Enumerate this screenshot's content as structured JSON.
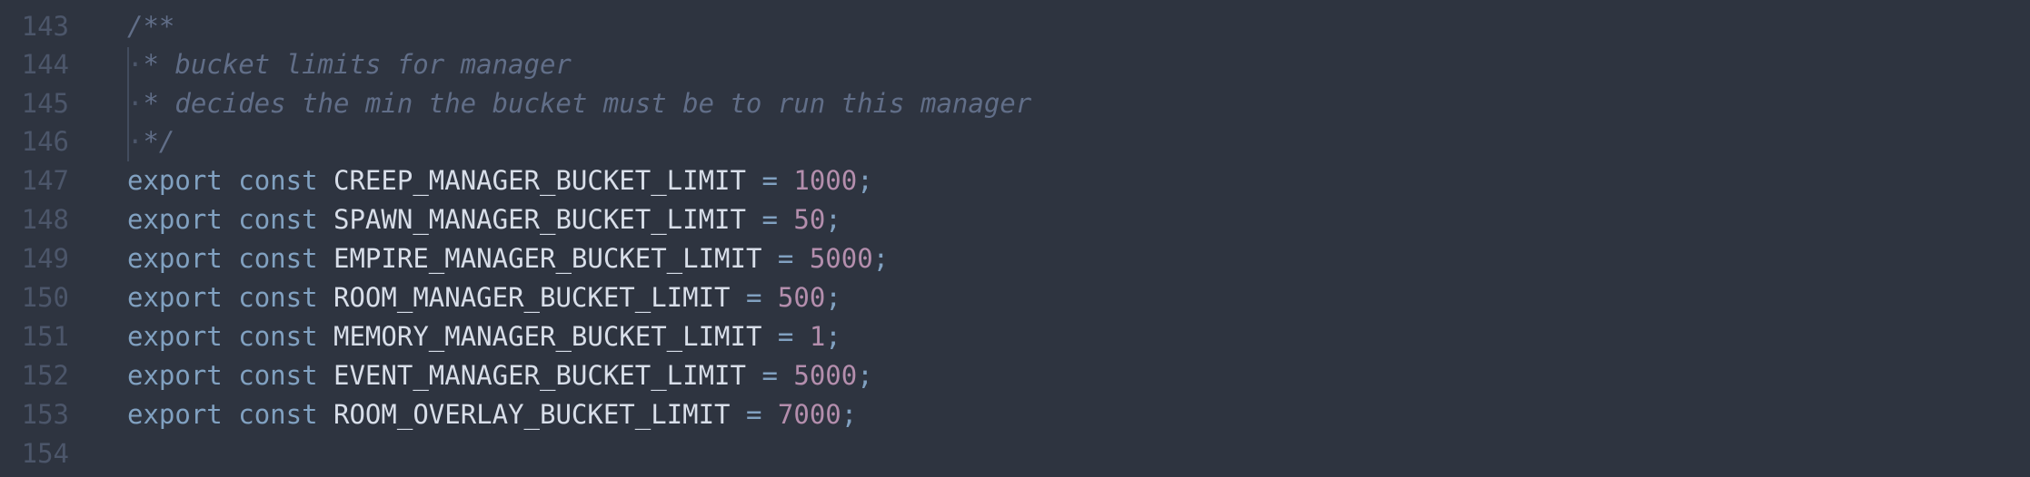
{
  "editor": {
    "lines": [
      {
        "number": "143",
        "comment": "/**"
      },
      {
        "number": "144",
        "dot": "·",
        "comment": "* bucket limits for manager"
      },
      {
        "number": "145",
        "dot": "·",
        "comment": "* decides the min the bucket must be to run this manager"
      },
      {
        "number": "146",
        "dot": "·",
        "comment": "*/"
      },
      {
        "number": "147",
        "kw1": "export",
        "kw2": "const",
        "name": "CREEP_MANAGER_BUCKET_LIMIT",
        "op": "=",
        "value": "1000",
        "end": ";"
      },
      {
        "number": "148",
        "kw1": "export",
        "kw2": "const",
        "name": "SPAWN_MANAGER_BUCKET_LIMIT",
        "op": "=",
        "value": "50",
        "end": ";"
      },
      {
        "number": "149",
        "kw1": "export",
        "kw2": "const",
        "name": "EMPIRE_MANAGER_BUCKET_LIMIT",
        "op": "=",
        "value": "5000",
        "end": ";"
      },
      {
        "number": "150",
        "kw1": "export",
        "kw2": "const",
        "name": "ROOM_MANAGER_BUCKET_LIMIT",
        "op": "=",
        "value": "500",
        "end": ";"
      },
      {
        "number": "151",
        "kw1": "export",
        "kw2": "const",
        "name": "MEMORY_MANAGER_BUCKET_LIMIT",
        "op": "=",
        "value": "1",
        "end": ";"
      },
      {
        "number": "152",
        "kw1": "export",
        "kw2": "const",
        "name": "EVENT_MANAGER_BUCKET_LIMIT",
        "op": "=",
        "value": "5000",
        "end": ";"
      },
      {
        "number": "153",
        "kw1": "export",
        "kw2": "const",
        "name": "ROOM_OVERLAY_BUCKET_LIMIT",
        "op": "=",
        "value": "7000",
        "end": ";"
      },
      {
        "number": "154"
      }
    ]
  },
  "colors": {
    "background": "#2e3440",
    "line_number": "#4c566a",
    "comment": "#616e88",
    "keyword": "#81a1c1",
    "identifier": "#d8dee9",
    "number": "#b48ead"
  }
}
